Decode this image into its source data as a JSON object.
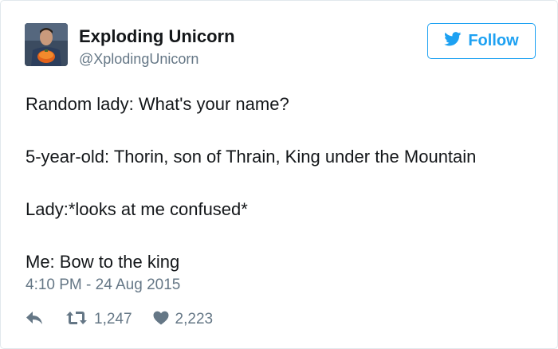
{
  "tweet": {
    "author": {
      "display_name": "Exploding Unicorn",
      "handle": "@XplodingUnicorn"
    },
    "follow_button": {
      "label": "Follow",
      "icon": "twitter-bird-icon"
    },
    "lines": [
      "Random lady: What's your name?",
      "5-year-old: Thorin, son of Thrain, King under the Mountain",
      "Lady:*looks at me confused*",
      "Me: Bow to the king"
    ],
    "timestamp": "4:10 PM - 24 Aug 2015",
    "actions": {
      "reply": {
        "icon": "reply-icon"
      },
      "retweet": {
        "icon": "retweet-icon",
        "count": "1,247"
      },
      "like": {
        "icon": "heart-icon",
        "count": "2,223"
      }
    },
    "colors": {
      "accent": "#1da1f2",
      "muted": "#657786",
      "text": "#14171a",
      "border": "#e1e8ed"
    }
  }
}
